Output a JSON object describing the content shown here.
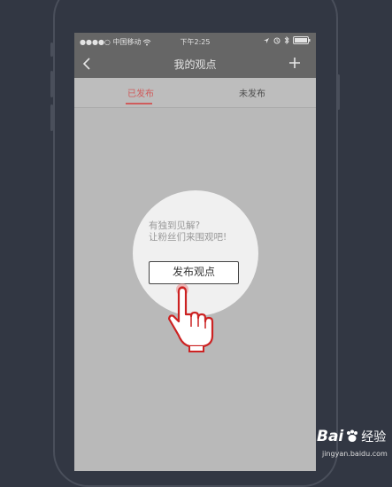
{
  "statusbar": {
    "carrier": "●●●●○ 中国移动",
    "time": "下午2:25",
    "icons": [
      "signal-dots-icon",
      "wifi-icon",
      "location-icon",
      "alarm-icon",
      "bluetooth-icon",
      "battery-icon"
    ]
  },
  "navbar": {
    "back_icon": "chevron-left-icon",
    "title": "我的观点",
    "add_icon": "plus-icon"
  },
  "tabs": [
    {
      "label": "已发布",
      "active": true
    },
    {
      "label": "未发布",
      "active": false
    }
  ],
  "empty_state": {
    "line1": "有独到见解?",
    "line2": "让粉丝们来围观吧!",
    "button_label": "发布观点",
    "hand_icon": "pointing-hand-cursor-icon"
  },
  "watermark": {
    "brand": "Bai",
    "brand2": "经验",
    "url": "jingyan.baidu.com"
  },
  "colors": {
    "background": "#323743",
    "header": "#666666",
    "overlay": "#b9b9b9",
    "active_tab": "#cf5c5c"
  }
}
